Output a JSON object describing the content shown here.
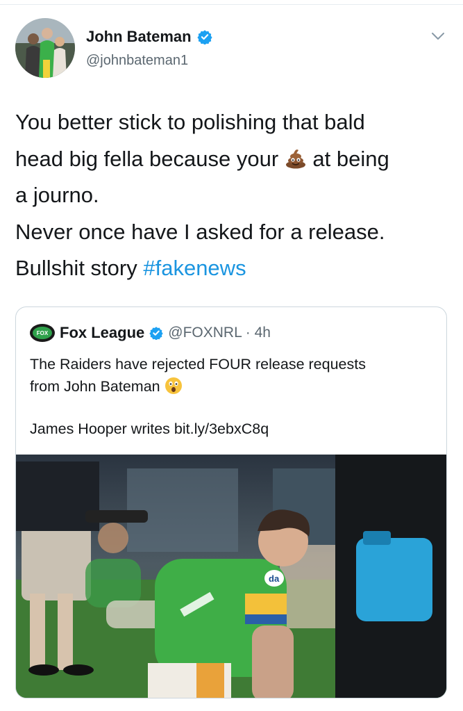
{
  "tweet": {
    "author": {
      "name": "John Bateman",
      "handle": "@johnbateman1",
      "verified": true,
      "avatar_icon": "profile-photo"
    },
    "text_lines": [
      "You better stick to polishing that bald",
      "head big fella because your",
      "at being",
      "a journo.",
      "Never once have I asked for a release.",
      "Bullshit story",
      "#fakenews"
    ],
    "emoji": "poop-emoji",
    "menu_icon": "chevron-down-icon",
    "quoted": {
      "name": "Fox League",
      "handle_time": "@FOXNRL · 4h",
      "verified": true,
      "logo_text": "FOX",
      "text_lines": [
        "The Raiders have rejected FOUR release requests",
        "from John Bateman"
      ],
      "emoji": "astonished-face-emoji",
      "link_line": "James Hooper writes bit.ly/3ebxC8q",
      "media_icon": "rugby-player-photo",
      "jersey_logo": "da"
    }
  },
  "colors": {
    "link": "#1b95e0",
    "verified": "#1da1f2",
    "jersey": "#46b848",
    "muted": "#5b6770",
    "border": "#ccd6dd"
  }
}
